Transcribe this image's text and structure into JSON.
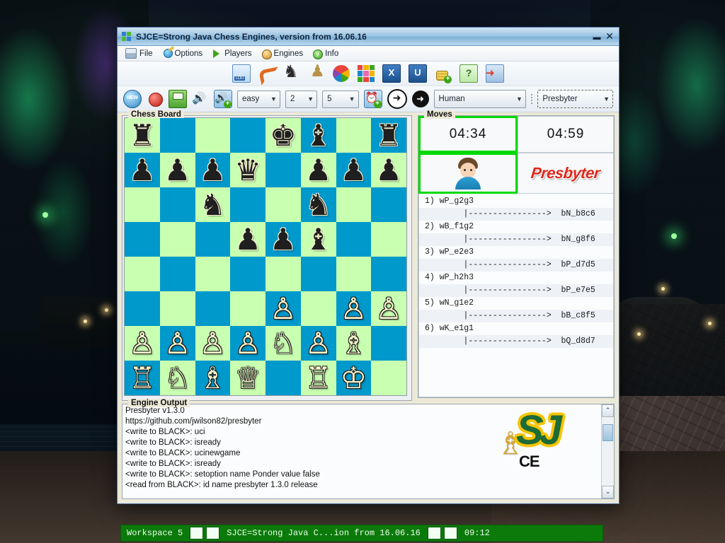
{
  "window": {
    "title": "SJCE=Strong Java Chess Engines, version from 16.06.16",
    "minimize_label": "▬",
    "close_label": "✕"
  },
  "menu": {
    "items": [
      {
        "label": "File",
        "icon": "folder-icon"
      },
      {
        "label": "Options",
        "icon": "wrench-icon"
      },
      {
        "label": "Players",
        "icon": "play-triangle-icon"
      },
      {
        "label": "Engines",
        "icon": "chess-engine-icon"
      },
      {
        "label": "Info",
        "icon": "info-icon"
      }
    ]
  },
  "toolbar_top": {
    "buttons": [
      {
        "name": "log-file-button",
        "icon": "log-document-icon",
        "label": "LOG"
      },
      {
        "name": "undo-move-button",
        "icon": "undo-arrow-icon",
        "label": ""
      },
      {
        "name": "black-knight-button",
        "icon": "black-knight-icon",
        "label": "♞"
      },
      {
        "name": "gold-pawn-button",
        "icon": "gold-pawn-icon",
        "label": "♟"
      },
      {
        "name": "pinwheel-button",
        "icon": "pinwheel-icon",
        "label": ""
      },
      {
        "name": "color-grid-button",
        "icon": "color-grid-icon",
        "label": ""
      },
      {
        "name": "export-x-button",
        "icon": "letter-x-icon",
        "label": "X"
      },
      {
        "name": "uci-u-button",
        "icon": "letter-u-icon",
        "label": "U"
      },
      {
        "name": "add-coins-button",
        "icon": "add-coins-icon",
        "label": ""
      },
      {
        "name": "help-button",
        "icon": "help-book-icon",
        "label": "?"
      },
      {
        "name": "exit-button",
        "icon": "exit-door-icon",
        "label": ""
      }
    ]
  },
  "toolbar_bottom": {
    "new_game_label": "NEW",
    "buttons": [
      {
        "name": "new-game-button",
        "icon": "new-badge-icon"
      },
      {
        "name": "stop-button",
        "icon": "red-stop-icon"
      },
      {
        "name": "save-game-button",
        "icon": "floppy-save-icon"
      },
      {
        "name": "sound-button",
        "icon": "speaker-icon"
      },
      {
        "name": "add-sound-button",
        "icon": "speaker-plus-icon"
      },
      {
        "name": "add-clock-button",
        "icon": "alarm-clock-plus-icon"
      },
      {
        "name": "step-forward-button",
        "icon": "arrow-right-circle-outline-icon"
      },
      {
        "name": "play-move-button",
        "icon": "arrow-right-circle-filled-icon"
      }
    ],
    "level": {
      "value": "easy",
      "arrow": "▼"
    },
    "depth": {
      "value": "2",
      "arrow": "▼"
    },
    "threads": {
      "value": "5",
      "arrow": "▼"
    },
    "white_player": {
      "value": "Human",
      "arrow": "▼"
    },
    "black_player": {
      "value": "Presbyter",
      "arrow": "▼"
    }
  },
  "chess_board": {
    "title": "Chess Board",
    "light_square_color": "#c8ffb0",
    "dark_square_color": "#0099cc",
    "ranks": [
      [
        "r",
        "",
        "",
        "",
        "k",
        "b",
        "",
        "r"
      ],
      [
        "p",
        "p",
        "p",
        "q",
        "",
        "p",
        "p",
        "p"
      ],
      [
        "",
        "",
        "n",
        "",
        "",
        "n",
        "",
        ""
      ],
      [
        "",
        "",
        "",
        "p",
        "p",
        "b",
        "",
        ""
      ],
      [
        "",
        "",
        "",
        "",
        "",
        "",
        "",
        ""
      ],
      [
        "",
        "",
        "",
        "",
        "P",
        "",
        "P",
        "P"
      ],
      [
        "P",
        "P",
        "P",
        "P",
        "N",
        "P",
        "B",
        ""
      ],
      [
        "R",
        "N",
        "B",
        "Q",
        "",
        "R",
        "K",
        ""
      ]
    ],
    "glyphs": {
      "K": "♔",
      "Q": "♕",
      "R": "♖",
      "B": "♗",
      "N": "♘",
      "P": "♙",
      "k": "♚",
      "q": "♛",
      "r": "♜",
      "b": "♝",
      "n": "♞",
      "p": "♟"
    }
  },
  "moves": {
    "title": "Moves",
    "white_clock": "04:34",
    "black_clock": "04:59",
    "white_player_name": "Human",
    "black_player_name": "Presbyter",
    "white_active": true,
    "active_border_color": "#00d900",
    "list": [
      {
        "white": "1) wP_g2g3",
        "black": "     |---------------->  bN_b8c6"
      },
      {
        "white": "2) wB_f1g2",
        "black": "     |---------------->  bN_g8f6"
      },
      {
        "white": "3) wP_e2e3",
        "black": "     |---------------->  bP_d7d5"
      },
      {
        "white": "4) wP_h2h3",
        "black": "     |---------------->  bP_e7e5"
      },
      {
        "white": "5) wN_g1e2",
        "black": "     |---------------->  bB_c8f5"
      },
      {
        "white": "6) wK_e1g1",
        "black": "     |---------------->  bQ_d8d7"
      }
    ]
  },
  "engine_output": {
    "title": "Engine Output",
    "lines": [
      "Presbyter v1.3.0",
      "https://github.com/jwilson82/presbyter",
      "<write to BLACK>: uci",
      "<write to BLACK>: isready",
      "<write to BLACK>: ucinewgame",
      "<write to BLACK>: isready",
      "<write to BLACK>: setoption name Ponder value false",
      "<read from BLACK>: id name presbyter 1.3.0 release"
    ],
    "logo": {
      "text": "SJ",
      "sub": "CE",
      "bishop": "♗"
    },
    "scroll_up": "⌃",
    "scroll_down": "⌄"
  },
  "taskbar": {
    "workspace": "Workspace 5",
    "window_title": "SJCE=Strong Java C...ion from 16.06.16",
    "clock": "09:12",
    "background_color": "#0b7a0b"
  }
}
